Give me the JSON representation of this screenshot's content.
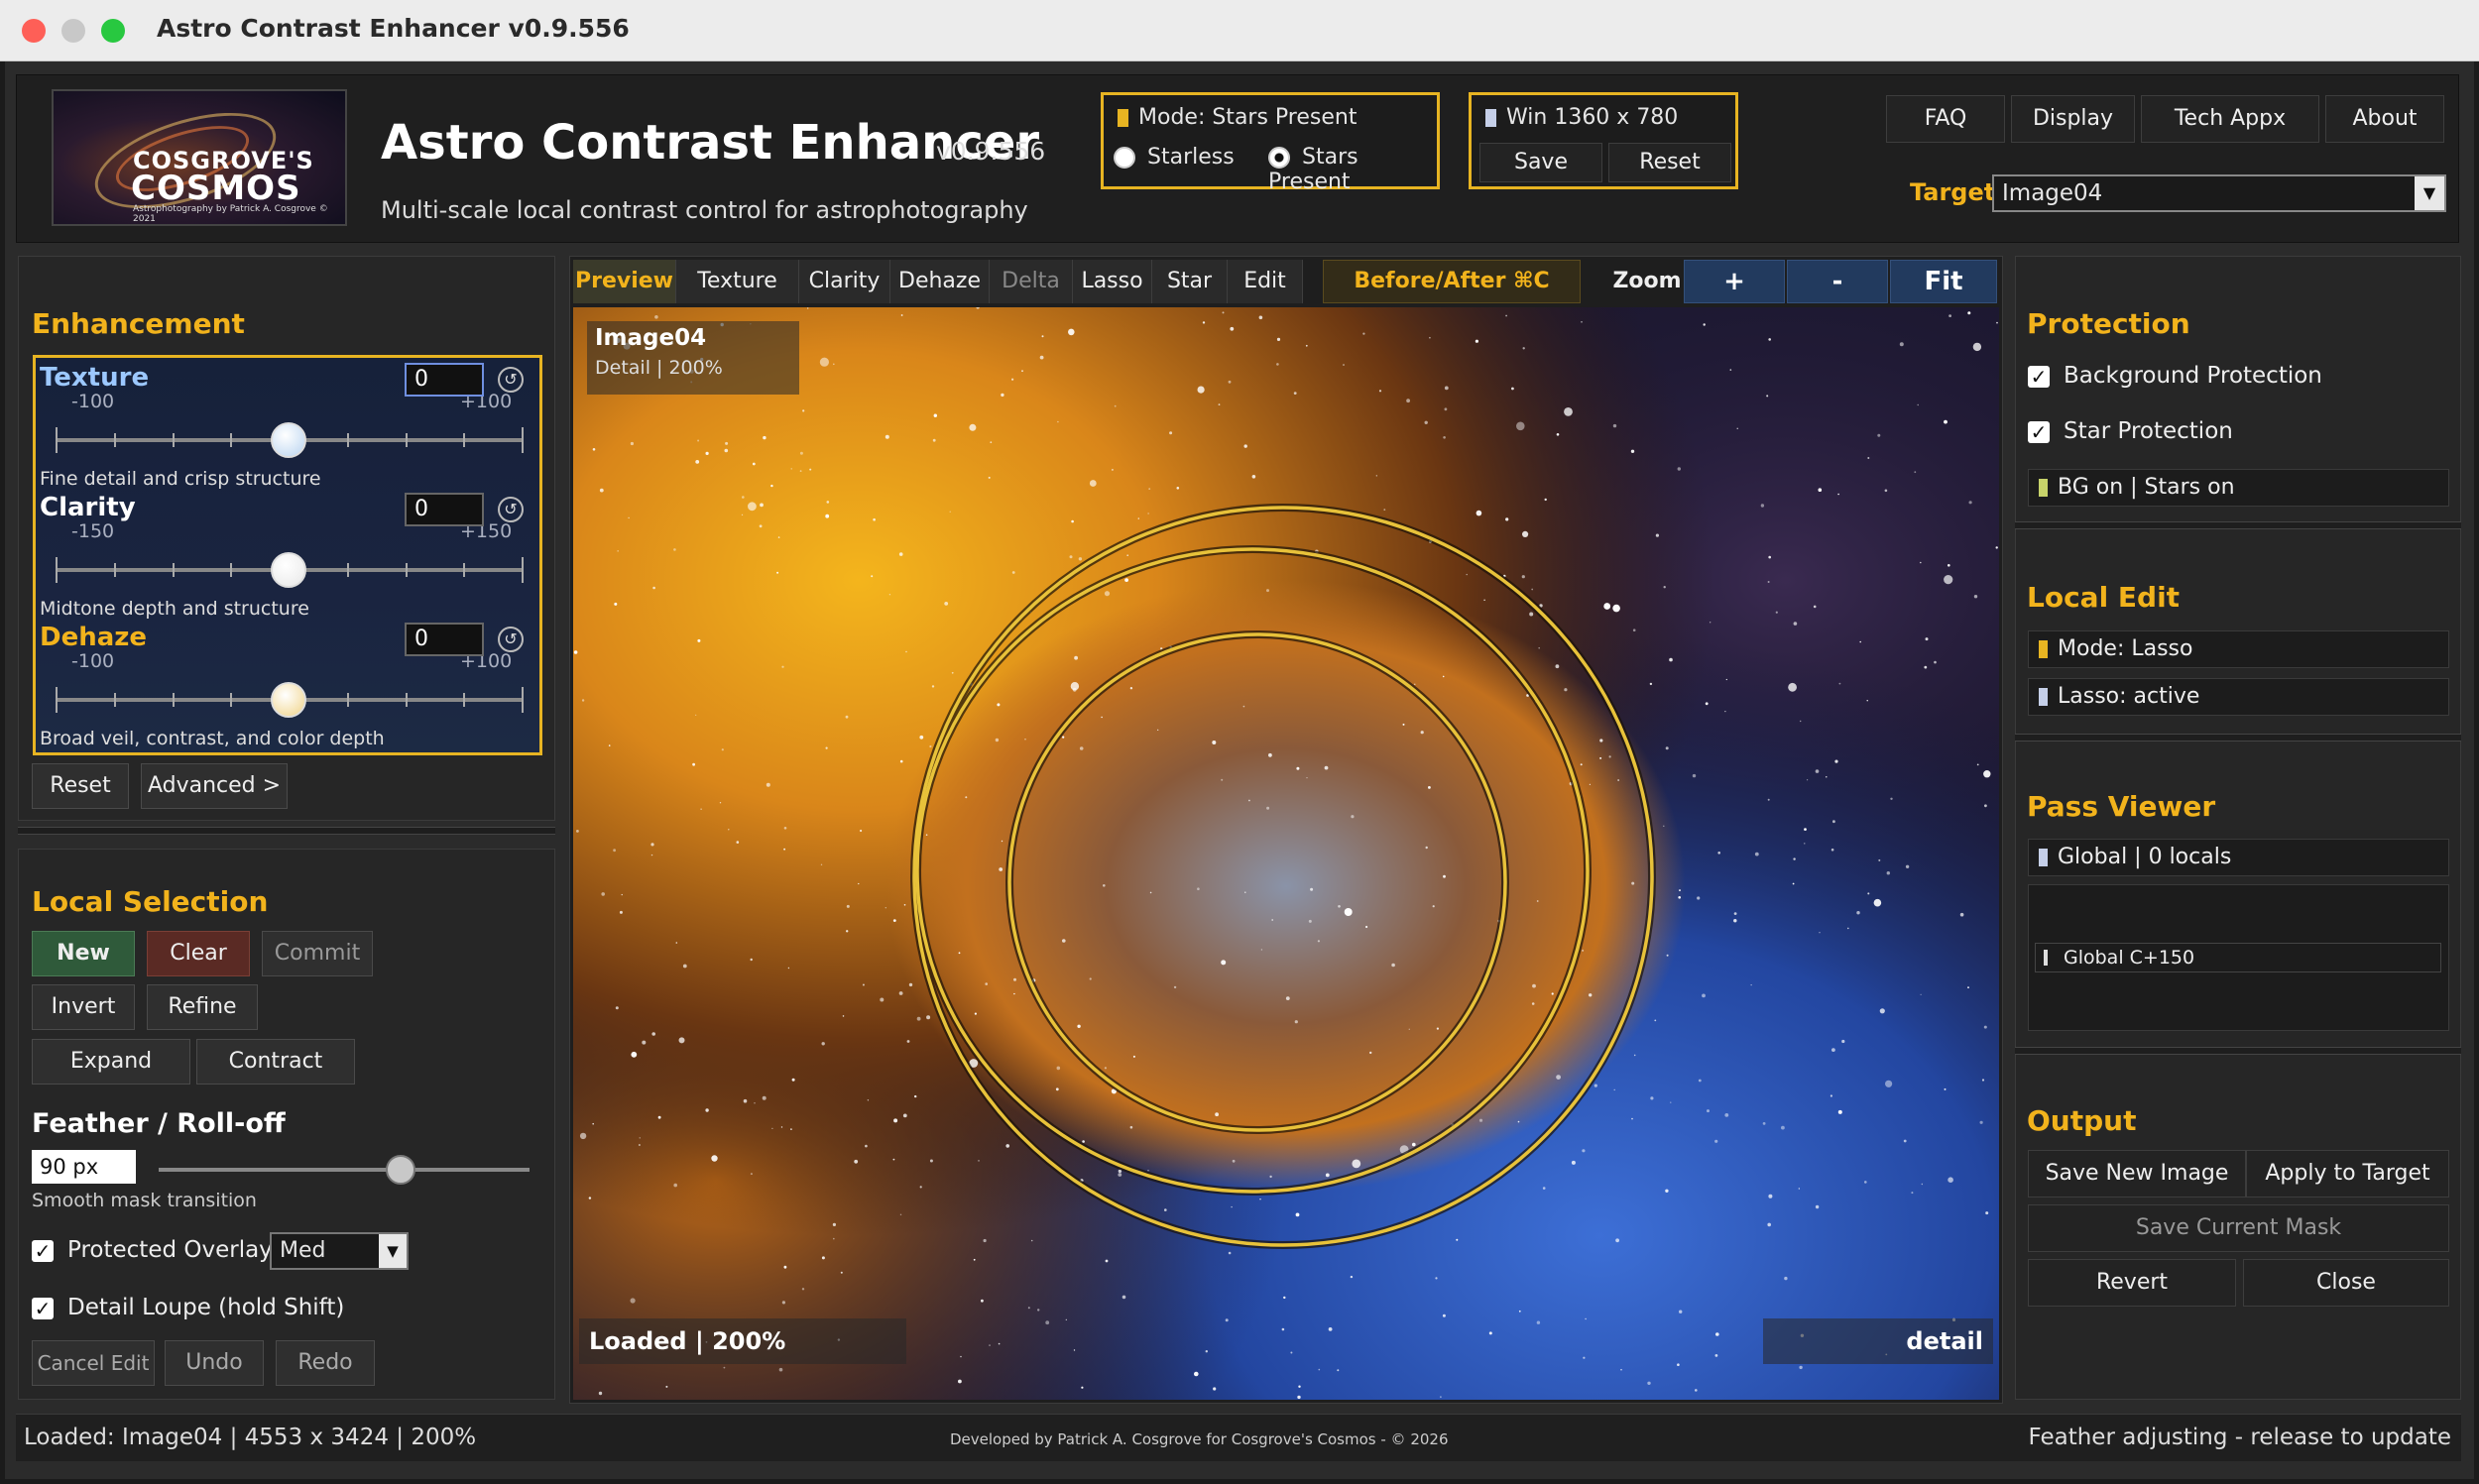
{
  "window": {
    "title": "Astro Contrast Enhancer v0.9.556"
  },
  "header": {
    "logo_line1": "COSGROVE'S",
    "logo_line2": "COSMOS",
    "logo_line3": "Astrophotography by Patrick A. Cosgrove © 2021",
    "app_name": "Astro Contrast Enhancer",
    "version": "v0.9.556",
    "tagline": "Multi-scale local contrast control for astrophotography",
    "mode_status": "Mode: Stars Present",
    "radio_starless": "Starless",
    "radio_stars_present": "Stars Present",
    "win_status": "Win 1360 x 780",
    "save_label": "Save",
    "reset_label": "Reset",
    "nav": [
      "FAQ",
      "Display",
      "Tech Appx",
      "About"
    ],
    "target_label": "Target",
    "target_value": "Image04"
  },
  "enhancement": {
    "title": "Enhancement",
    "sliders": [
      {
        "name": "Texture",
        "min": "-100",
        "max": "+100",
        "value": "0",
        "desc": "Fine detail and crisp structure",
        "level": 0.5
      },
      {
        "name": "Clarity",
        "min": "-150",
        "max": "+150",
        "value": "0",
        "desc": "Midtone depth and structure",
        "level": 0.5
      },
      {
        "name": "Dehaze",
        "min": "-100",
        "max": "+100",
        "value": "0",
        "desc": "Broad veil, contrast, and color depth",
        "level": 0.5
      }
    ],
    "reset_label": "Reset",
    "advanced_label": "Advanced >"
  },
  "local_selection": {
    "title": "Local Selection",
    "new_label": "New",
    "clear_label": "Clear",
    "commit_label": "Commit",
    "invert_label": "Invert",
    "refine_label": "Refine",
    "expand_label": "Expand",
    "contract_label": "Contract",
    "feather_title": "Feather / Roll-off",
    "feather_value": "90 px",
    "feather_level": 0.6,
    "feather_desc": "Smooth mask transition",
    "protected_overlay_label": "Protected Overlay",
    "protected_overlay_value": "Med",
    "detail_loupe_label": "Detail Loupe (hold Shift)",
    "cancel_edit_label": "Cancel Edit",
    "undo_label": "Undo",
    "redo_label": "Redo"
  },
  "tabs": [
    "Preview",
    "Texture",
    "Clarity",
    "Dehaze",
    "Delta",
    "Lasso",
    "Star",
    "Edit"
  ],
  "before_after": "Before/After ⌘C",
  "zoom": {
    "label": "Zoom",
    "plus": "+",
    "minus": "-",
    "fit": "Fit"
  },
  "canvas": {
    "image_name": "Image04",
    "image_sub": "Detail | 200%",
    "loaded_label": "Loaded | 200%",
    "detail_label": "detail"
  },
  "protection": {
    "title": "Protection",
    "bg_label": "Background Protection",
    "star_label": "Star Protection",
    "status": "BG on | Stars on"
  },
  "local_edit": {
    "title": "Local Edit",
    "mode": "Mode: Lasso",
    "lasso": "Lasso: active"
  },
  "pass_viewer": {
    "title": "Pass Viewer",
    "status": "Global | 0 locals",
    "item": "Global C+150"
  },
  "output": {
    "title": "Output",
    "save_new_label": "Save New Image",
    "apply_label": "Apply to Target",
    "save_mask_label": "Save Current Mask",
    "revert_label": "Revert",
    "close_label": "Close"
  },
  "statusbar": {
    "left": "Loaded: Image04 | 4553 x 3424 | 200%",
    "center": "Developed by Patrick A. Cosgrove for Cosgrove's Cosmos - © 2026",
    "right": "Feather adjusting - release to update"
  },
  "colors": {
    "accent": "#f2b31c",
    "canvas_ring": "#e8c23a",
    "tab_active": "#f2b31c"
  }
}
